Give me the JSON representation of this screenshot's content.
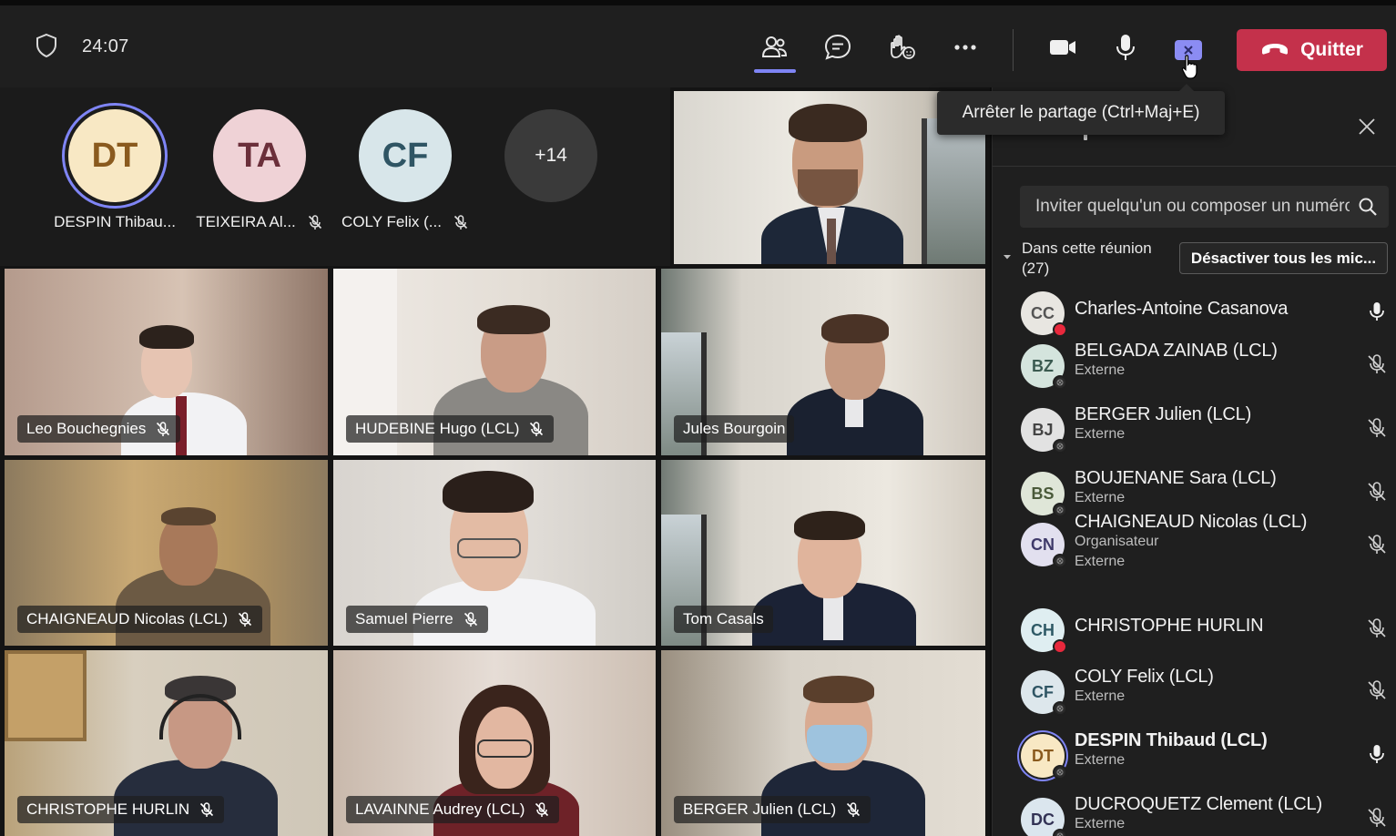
{
  "toolbar": {
    "timer": "24:07",
    "leave_label": "Quitter"
  },
  "tooltip": "Arrêter le partage (Ctrl+Maj+E)",
  "avatars": [
    {
      "initials": "DT",
      "name": "DESPIN Thibau...",
      "bg": "#f8e8c4",
      "fg": "#8a5a1e",
      "ring": true,
      "muted": false
    },
    {
      "initials": "TA",
      "name": "TEIXEIRA Al...",
      "bg": "#efd2d6",
      "fg": "#6b2f3a",
      "ring": false,
      "muted": true
    },
    {
      "initials": "CF",
      "name": "COLY Felix (...",
      "bg": "#d8e6ea",
      "fg": "#2f5564",
      "ring": false,
      "muted": true
    },
    {
      "initials": "+14",
      "name": "",
      "bg": "#3a3a3a",
      "fg": "#f0f0f0",
      "ring": false,
      "muted": false
    }
  ],
  "tiles": [
    {
      "label": "Leo Bouchegnies",
      "muted": true
    },
    {
      "label": "HUDEBINE Hugo (LCL)",
      "muted": true
    },
    {
      "label": "Jules Bourgoin",
      "muted": false
    },
    {
      "label": "CHAIGNEAUD Nicolas (LCL)",
      "muted": true
    },
    {
      "label": "Samuel Pierre",
      "muted": true
    },
    {
      "label": "Tom Casals",
      "muted": false
    },
    {
      "label": "CHRISTOPHE HURLIN",
      "muted": true
    },
    {
      "label": "LAVAINNE Audrey (LCL)",
      "muted": true
    },
    {
      "label": "BERGER Julien (LCL)",
      "muted": true
    }
  ],
  "panel": {
    "invite_placeholder": "Inviter quelqu'un ou composer un numéro",
    "section_line1": "Dans cette réunion",
    "section_line2": "(27)",
    "mute_all_label": "Désactiver tous les mic..."
  },
  "participants": [
    {
      "initials": "CC",
      "name": "Charles-Antoine Casanova",
      "subs": [],
      "bold": false,
      "status": "busy",
      "mic": "on",
      "bg": "#e8e6e1",
      "fg": "#555"
    },
    {
      "initials": "BZ",
      "name": "BELGADA ZAINAB (LCL)",
      "subs": [
        "Externe"
      ],
      "bold": false,
      "status": "offline",
      "mic": "off",
      "bg": "#d4e4dd",
      "fg": "#3b5a50"
    },
    {
      "initials": "BJ",
      "name": "BERGER Julien (LCL)",
      "subs": [
        "Externe"
      ],
      "bold": false,
      "status": "offline",
      "mic": "off",
      "bg": "#e2e2e2",
      "fg": "#444"
    },
    {
      "initials": "BS",
      "name": "BOUJENANE Sara (LCL)",
      "subs": [
        "Externe"
      ],
      "bold": false,
      "status": "offline",
      "mic": "off",
      "bg": "#dfe6d8",
      "fg": "#4a5a3a"
    },
    {
      "initials": "CN",
      "name": "CHAIGNEAUD Nicolas (LCL)",
      "subs": [
        "Organisateur",
        "Externe"
      ],
      "bold": false,
      "status": "offline",
      "mic": "off",
      "bg": "#e2e0ef",
      "fg": "#3f3a6a"
    },
    {
      "initials": "CH",
      "name": "CHRISTOPHE HURLIN",
      "subs": [],
      "bold": false,
      "status": "busy",
      "mic": "off",
      "bg": "#dfeef1",
      "fg": "#2f5a66"
    },
    {
      "initials": "CF",
      "name": "COLY Felix (LCL)",
      "subs": [
        "Externe"
      ],
      "bold": false,
      "status": "offline",
      "mic": "off",
      "bg": "#dde7ec",
      "fg": "#2f5564"
    },
    {
      "initials": "DT",
      "name": "DESPIN Thibaud (LCL)",
      "subs": [
        "Externe"
      ],
      "bold": true,
      "status": "offline",
      "mic": "on",
      "bg": "#f8e8c4",
      "fg": "#8a5a1e"
    },
    {
      "initials": "DC",
      "name": "DUCROQUETZ Clement (LCL)",
      "subs": [
        "Externe"
      ],
      "bold": false,
      "status": "offline",
      "mic": "off",
      "bg": "#dbe6ee",
      "fg": "#335"
    }
  ],
  "colors": {
    "accent": "#7f85f5",
    "share_button": "#8b8cf3",
    "leave_red": "#c4314b",
    "busy_red": "#e8283c"
  }
}
